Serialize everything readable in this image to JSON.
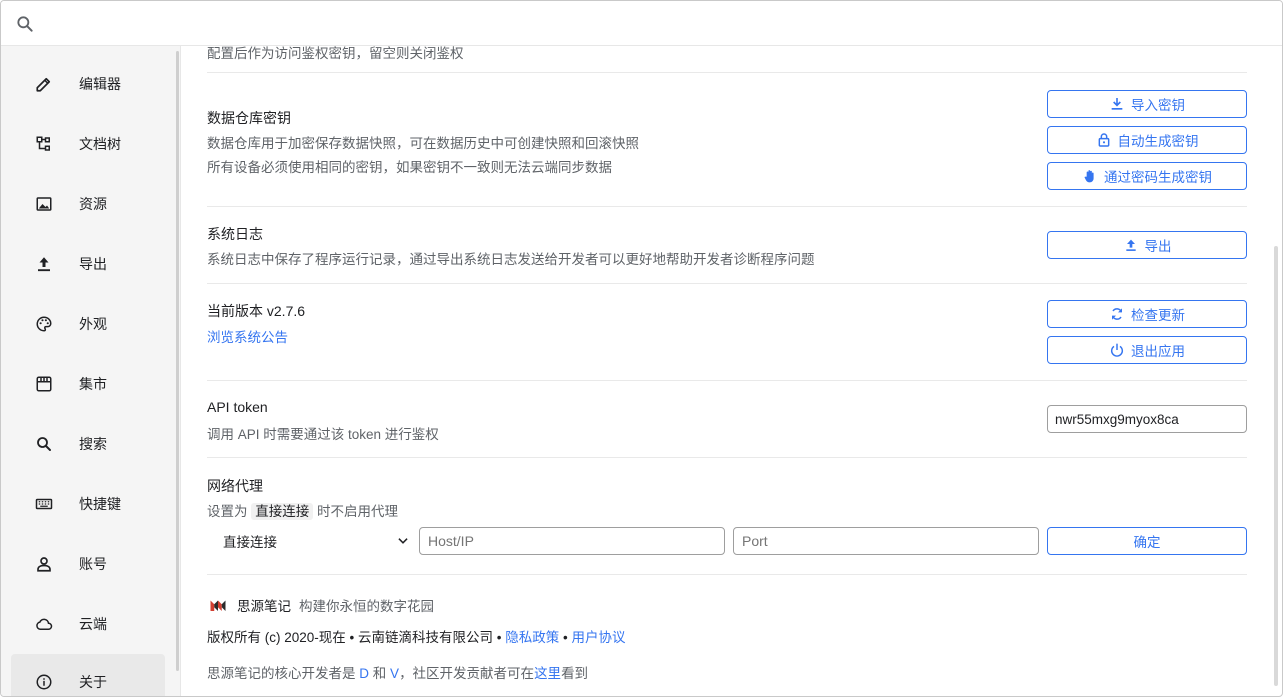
{
  "search": {
    "placeholder": "",
    "icon": "search-icon"
  },
  "sidebar": {
    "items": [
      {
        "label": "编辑器",
        "icon": "pencil-icon"
      },
      {
        "label": "文档树",
        "icon": "tree-icon"
      },
      {
        "label": "资源",
        "icon": "image-icon"
      },
      {
        "label": "导出",
        "icon": "upload-icon"
      },
      {
        "label": "外观",
        "icon": "palette-icon"
      },
      {
        "label": "集市",
        "icon": "store-icon"
      },
      {
        "label": "搜索",
        "icon": "search-icon"
      },
      {
        "label": "快捷键",
        "icon": "keyboard-icon"
      },
      {
        "label": "账号",
        "icon": "account-icon"
      },
      {
        "label": "云端",
        "icon": "cloud-icon"
      },
      {
        "label": "关于",
        "icon": "info-icon"
      }
    ],
    "active": "关于"
  },
  "content": {
    "partial_top": "配置后作为访问鉴权密钥，留空则关闭鉴权",
    "repo": {
      "title": "数据仓库密钥",
      "desc1": "数据仓库用于加密保存数据快照，可在数据历史中可创建快照和回滚快照",
      "desc2": "所有设备必须使用相同的密钥，如果密钥不一致则无法云端同步数据",
      "btn_import": "导入密钥",
      "btn_auto": "自动生成密钥",
      "btn_pass": "通过密码生成密钥"
    },
    "log": {
      "title": "系统日志",
      "desc": "系统日志中保存了程序运行记录，通过导出系统日志发送给开发者可以更好地帮助开发者诊断程序问题",
      "btn_export": "导出"
    },
    "version": {
      "title": "当前版本 v2.7.6",
      "link": "浏览系统公告",
      "btn_check": "检查更新",
      "btn_exit": "退出应用"
    },
    "api": {
      "title": "API token",
      "desc": "调用 API 时需要通过该 token 进行鉴权",
      "token": "nwr55mxg9myox8ca"
    },
    "proxy": {
      "title": "网络代理",
      "desc_pre": "设置为",
      "desc_code": "直接连接",
      "desc_post": "时不启用代理",
      "select_value": "直接连接",
      "host_placeholder": "Host/IP",
      "port_placeholder": "Port",
      "btn_ok": "确定"
    },
    "footer": {
      "app_name": "思源笔记",
      "slogan": "构建你永恒的数字花园",
      "copyright": "版权所有 (c) 2020-现在 • 云南链滴科技有限公司 •",
      "privacy": "隐私政策",
      "dot": "•",
      "terms": "用户协议",
      "core_pre": "思源笔记的核心开发者是",
      "dev_d": "D",
      "and": "和",
      "dev_v": "V",
      "core_mid": "，社区开发贡献者可在",
      "here": "这里",
      "core_post": "看到"
    }
  },
  "colors": {
    "accent": "#3575f0",
    "brand": "#d23f31"
  }
}
